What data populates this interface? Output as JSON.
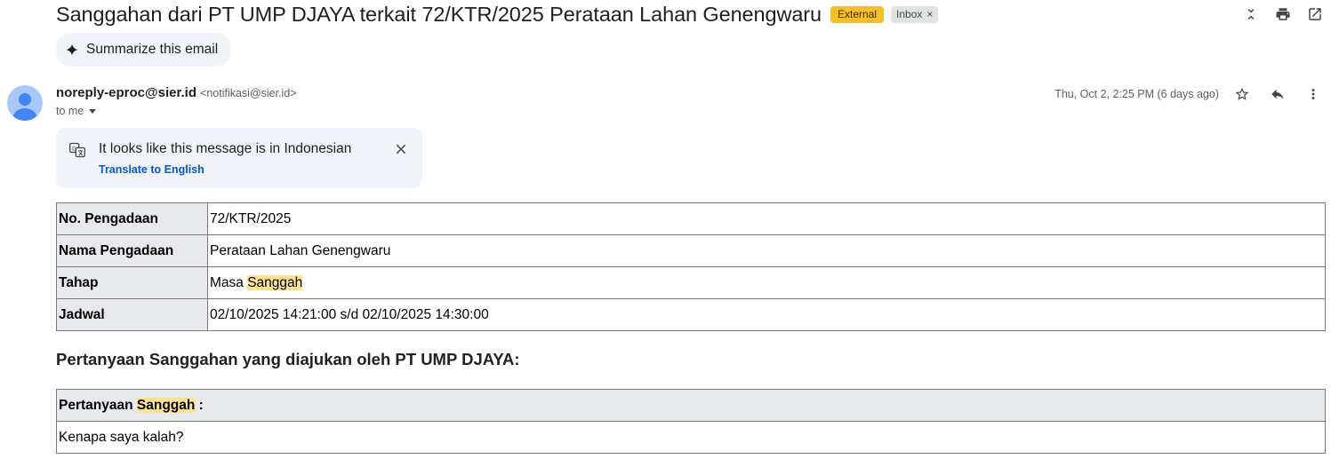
{
  "email": {
    "subject": "Sanggahan dari PT UMP DJAYA terkait 72/KTR/2025 Perataan Lahan Genengwaru",
    "labels": {
      "external": "External",
      "inbox": "Inbox",
      "remove_symbol": "×"
    },
    "summarize_label": "Summarize this email",
    "sender": {
      "name": "noreply-eproc@sier.id",
      "email": "<notifikasi@sier.id>"
    },
    "to_line": "to me",
    "date": "Thu, Oct 2, 2:25 PM (6 days ago)"
  },
  "translate_banner": {
    "message": "It looks like this message is in Indonesian",
    "link": "Translate to English"
  },
  "info_table": {
    "rows": [
      {
        "key": "No. Pengadaan",
        "value": "72/KTR/2025"
      },
      {
        "key": "Nama Pengadaan",
        "value": "Perataan Lahan Genengwaru"
      },
      {
        "key": "Tahap",
        "value_prefix": "Masa ",
        "value_highlight": "Sanggah"
      },
      {
        "key": "Jadwal",
        "value": "02/10/2025 14:21:00 s/d 02/10/2025 14:30:00"
      }
    ]
  },
  "body_heading": "Pertanyaan Sanggahan yang diajukan oleh PT UMP DJAYA:",
  "question_table": {
    "header_prefix": "Pertanyaan ",
    "header_highlight": "Sanggah",
    "header_suffix": " :",
    "answer": "Kenapa saya kalah?"
  },
  "colors": {
    "accent": "#0b57d0",
    "external_label": "#f6bf26",
    "highlight": "#fde293"
  },
  "icons": [
    "collapse-icon",
    "print-icon",
    "open-in-new-icon",
    "sparkle-icon",
    "avatar-icon",
    "star-icon",
    "reply-icon",
    "more-vert-icon",
    "translate-icon",
    "close-icon"
  ]
}
